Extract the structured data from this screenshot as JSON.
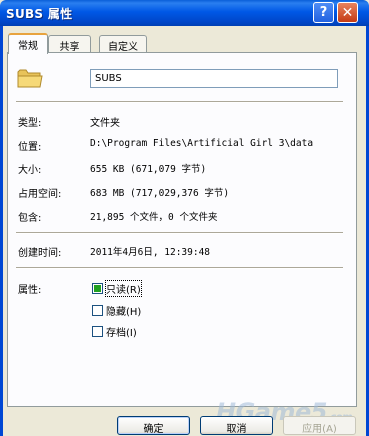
{
  "window": {
    "title": "SUBS 属性",
    "help_glyph": "?",
    "close_glyph": "✕"
  },
  "tabs": [
    {
      "label": "常规",
      "active": true
    },
    {
      "label": "共享",
      "active": false
    },
    {
      "label": "自定义",
      "active": false
    }
  ],
  "general": {
    "folder_icon": "folder-icon",
    "name": "SUBS",
    "type_label": "类型:",
    "type_value": "文件夹",
    "location_label": "位置:",
    "location_value": "D:\\Program Files\\Artificial Girl 3\\data",
    "size_label": "大小:",
    "size_value": "655 KB (671,079 字节)",
    "disk_label": "占用空间:",
    "disk_value": "683 MB (717,029,376 字节)",
    "contains_label": "包含:",
    "contains_value": "21,895 个文件，0 个文件夹",
    "created_label": "创建时间:",
    "created_value": "2011年4月6日, 12:39:48",
    "attrs_label": "属性:",
    "attributes": [
      {
        "label": "只读(R)",
        "checked": true
      },
      {
        "label": "隐藏(H)",
        "checked": false
      },
      {
        "label": "存档(I)",
        "checked": false
      }
    ]
  },
  "buttons": {
    "ok": "确定",
    "cancel": "取消",
    "apply": "应用(A)"
  },
  "watermark": {
    "text": "HGame5",
    "suffix": ".com"
  },
  "colors": {
    "titlebar": "#0058e6",
    "active_tab_accent": "#e8a33e",
    "close_button": "#c43b14",
    "checked_fill": "#21a121"
  }
}
